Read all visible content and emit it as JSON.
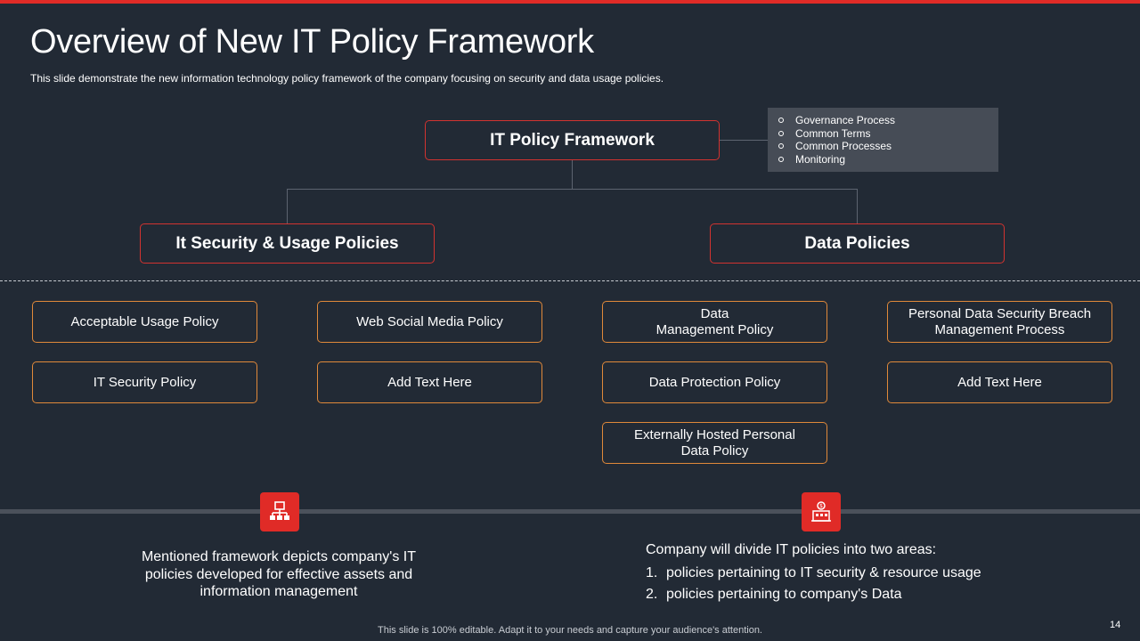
{
  "slide": {
    "title": "Overview of New IT Policy Framework",
    "subtitle": "This slide demonstrate the new information technology policy framework  of the company focusing on security and data usage policies.",
    "page_number": "14",
    "footer_note": "This slide is 100% editable. Adapt it to your needs and capture your audience's attention."
  },
  "framework": {
    "root": "IT Policy Framework",
    "components": [
      "Governance Process",
      "Common Terms",
      "Common Processes",
      "Monitoring"
    ],
    "left_branch": "It Security & Usage Policies",
    "right_branch": "Data Policies"
  },
  "policies": {
    "col1": [
      "Acceptable Usage Policy",
      "IT Security Policy"
    ],
    "col2": [
      "Web Social Media Policy",
      "Add Text Here"
    ],
    "col3": [
      "Data\nManagement Policy",
      "Data Protection Policy",
      "Externally Hosted Personal\nData Policy"
    ],
    "col4": [
      "Personal Data Security Breach\nManagement Process",
      "Add Text Here"
    ]
  },
  "bottom": {
    "left_icon": "network-diagram-icon",
    "right_icon": "money-building-icon",
    "left_text": "Mentioned framework depicts company's IT policies developed for effective assets and information management",
    "right_intro": "Company will divide IT policies into two areas:",
    "right_items": [
      {
        "num": "1.",
        "text": "policies pertaining to IT security & resource usage"
      },
      {
        "num": "2.",
        "text": "policies pertaining to company's Data"
      }
    ]
  },
  "colors": {
    "background": "#222a35",
    "accent_red": "#e02b27",
    "box_orange": "#e0893a",
    "info_panel": "#464c56"
  }
}
